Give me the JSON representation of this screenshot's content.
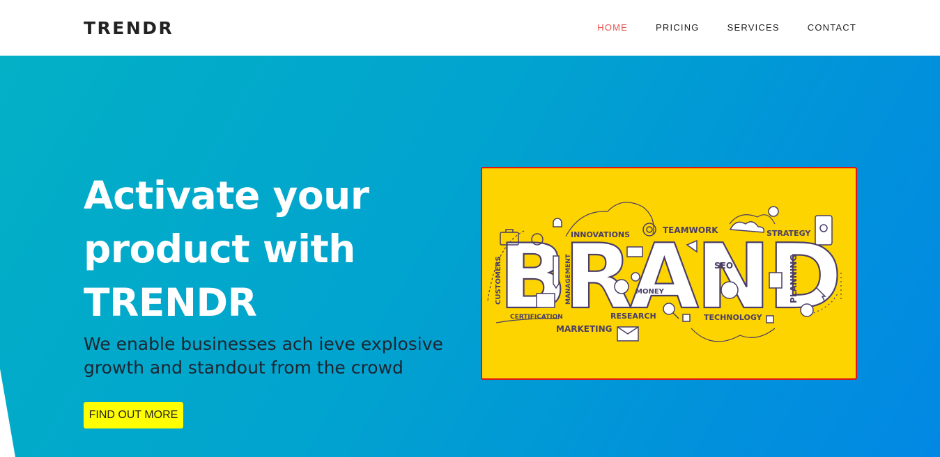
{
  "navbar": {
    "brand": "TRENDR",
    "links": [
      {
        "label": "HOME",
        "active": true
      },
      {
        "label": "PRICING",
        "active": false
      },
      {
        "label": "SERVICES",
        "active": false
      },
      {
        "label": "CONTACT",
        "active": false
      }
    ]
  },
  "hero": {
    "headline_lines": [
      "Activate your",
      "product with",
      "TRENDR"
    ],
    "subheadline_lines": [
      "We enable businesses ach ieve explosive",
      "growth and standout from the crowd"
    ],
    "cta_label": "FIND OUT MORE"
  },
  "illustration": {
    "word": "BRAND",
    "labels": {
      "innovations": "INNOVATIONS",
      "teamwork": "TEAMWORK",
      "strategy": "STRATEGY",
      "customers": "CUSTOMERS",
      "management": "MANAGEMENT",
      "seo": "SEO",
      "planning": "PLANNING",
      "money": "MONEY",
      "certification": "CERTIFICATION",
      "research": "RESEARCH",
      "technology": "TECHNOLOGY",
      "marketing": "MARKETING"
    }
  },
  "colors": {
    "accent": "#e8534e",
    "hero_start": "#03b0c6",
    "hero_end": "#0288e4",
    "cta": "#ffff00",
    "illustration_bg": "#fdd400",
    "illustration_border": "#e3140f"
  }
}
